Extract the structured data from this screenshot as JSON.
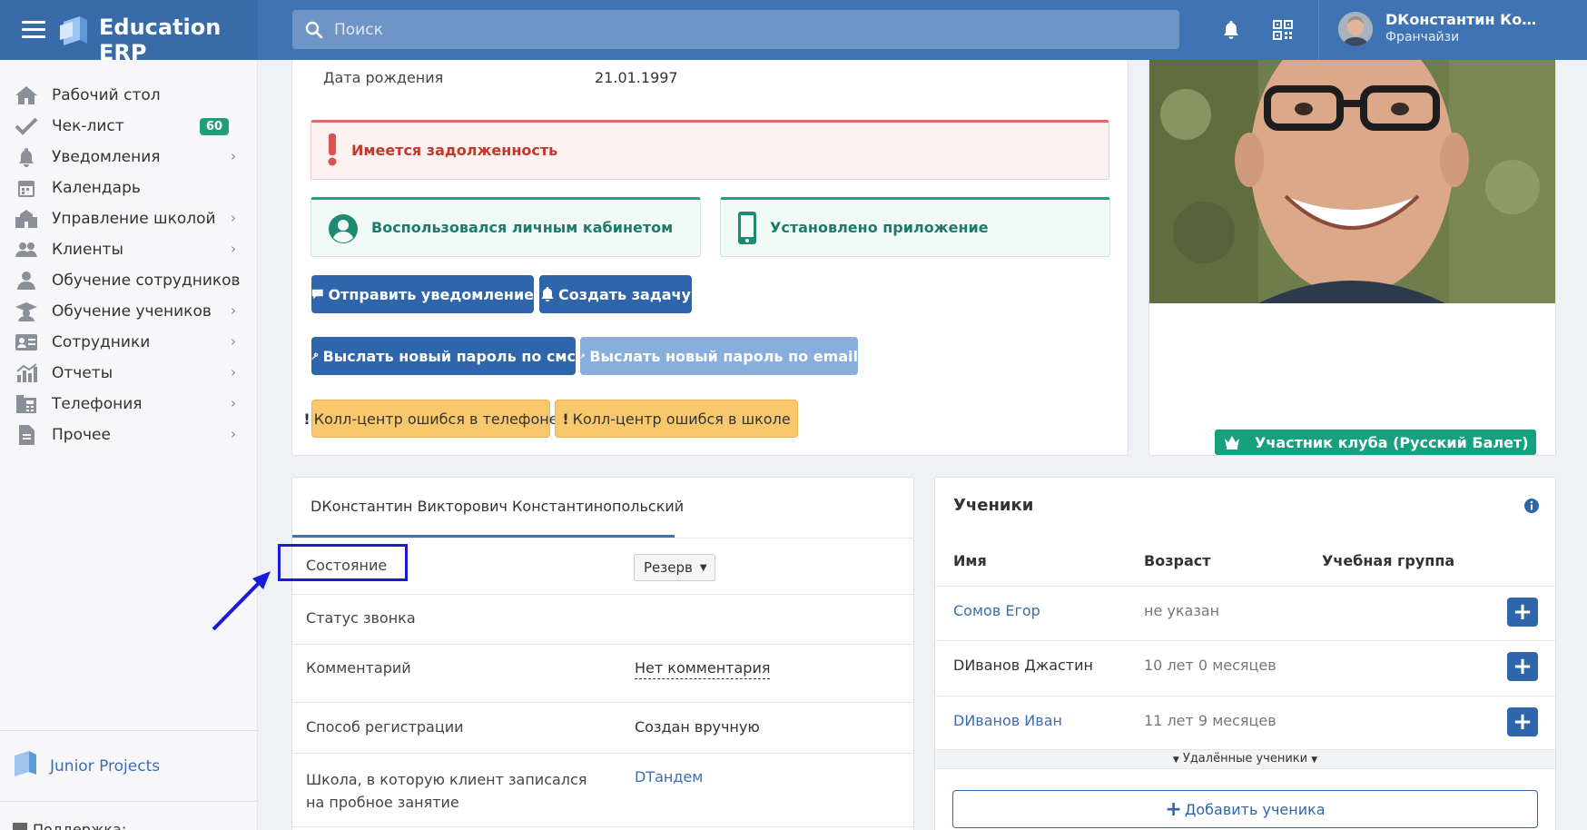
{
  "header": {
    "brand": "Education ERP",
    "search_placeholder": "Поиск",
    "user_name": "DКонстантин Константинопольский",
    "user_role": "Франчайзи"
  },
  "sidebar": {
    "items": [
      {
        "label": "Рабочий стол",
        "icon": "home-icon"
      },
      {
        "label": "Чек-лист",
        "icon": "check-icon",
        "badge": "60"
      },
      {
        "label": "Уведомления",
        "icon": "bell-icon"
      },
      {
        "label": "Календарь",
        "icon": "calendar-icon"
      },
      {
        "label": "Управление школой",
        "icon": "school-icon"
      },
      {
        "label": "Клиенты",
        "icon": "users-icon"
      },
      {
        "label": "Обучение сотрудников",
        "icon": "employee-training-icon"
      },
      {
        "label": "Обучение учеников",
        "icon": "graduation-cap-icon"
      },
      {
        "label": "Сотрудники",
        "icon": "id-card-icon"
      },
      {
        "label": "Отчеты",
        "icon": "chart-icon"
      },
      {
        "label": "Телефония",
        "icon": "phone-book-icon"
      },
      {
        "label": "Прочее",
        "icon": "file-icon"
      }
    ],
    "footer_brand": "Junior Projects",
    "support": "Поддержка:"
  },
  "profile": {
    "birth_label": "Дата рождения",
    "birth_value": "21.01.1997",
    "debt_alert": "Имеется задолженность",
    "cabinet_used": "Воспользовался личным кабинетом",
    "app_installed": "Установлено приложение",
    "btn_send_notification": "Отправить уведомление",
    "btn_create_task": "Создать задачу",
    "btn_password_sms": "Выслать новый пароль по смс",
    "btn_password_email": "Выслать новый пароль по email",
    "btn_callcenter_phone": "Колл-центр ошибся в телефоне",
    "btn_callcenter_school": "Колл-центр ошибся в школе",
    "club_badge": "Участник клуба (Русский Балет)"
  },
  "details": {
    "tab": "DКонстантин Викторович Константинопольский",
    "rows": [
      {
        "label": "Состояние",
        "value": "Резерв"
      },
      {
        "label": "Статус звонка",
        "value": ""
      },
      {
        "label": "Комментарий",
        "value": "Нет комментария"
      },
      {
        "label": "Способ регистрации",
        "value": "Создан вручную"
      },
      {
        "label": "Школа, в которую клиент записался на пробное занятие",
        "value": "DТандем"
      }
    ]
  },
  "students": {
    "title": "Ученики",
    "columns": [
      "Имя",
      "Возраст",
      "Учебная группа"
    ],
    "rows": [
      {
        "name": "Сомов Егор",
        "age": "не указан"
      },
      {
        "name": "DИванов Джастин",
        "age": "10 лет 0 месяцев"
      },
      {
        "name": "DИванов Иван",
        "age": "11 лет 9 месяцев"
      }
    ],
    "deleted_toggle": "Удалённые ученики",
    "add_button": "Добавить ученика"
  },
  "colors": {
    "header": "#3f73b3",
    "brand_bg": "#386ba8",
    "primary_button": "#2e65ab",
    "warning_button": "#fac86c",
    "success": "#17a07e",
    "danger": "#d9534f",
    "annotation": "#1a1adb"
  }
}
